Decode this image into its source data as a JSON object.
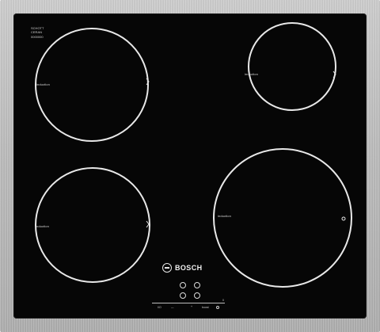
{
  "cooktop": {
    "glass_logo_line1": "SCHOTT",
    "glass_logo_line2": "CERAN",
    "glass_logo_line3": "0000000",
    "brand": "BOSCH",
    "colors": {
      "frame": "#b9b9b9",
      "glass": "#060606",
      "markings": "#e8e8e8"
    },
    "zones": [
      {
        "label": "induction",
        "size": "large"
      },
      {
        "label": "induction",
        "size": "small"
      },
      {
        "label": "induction",
        "size": "medium"
      },
      {
        "label": "induction",
        "size": "large"
      }
    ],
    "controls": {
      "left_text": "I/O",
      "mid_left_text": "—",
      "mid_text": "+",
      "right_text": "boost",
      "far_right_text": "0"
    }
  }
}
